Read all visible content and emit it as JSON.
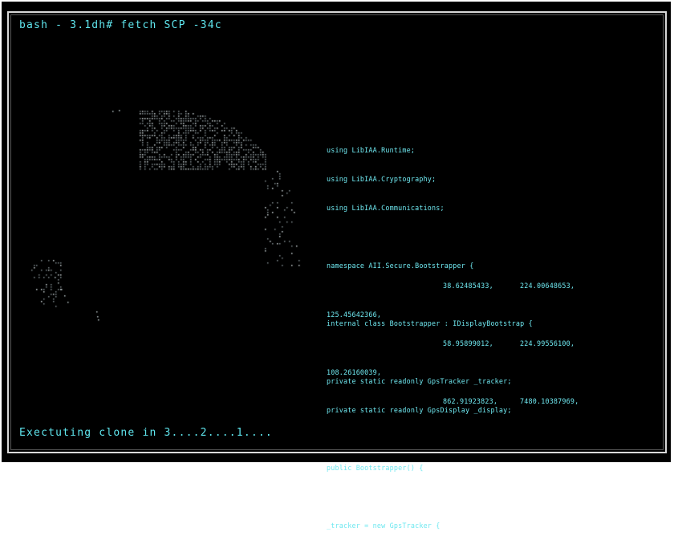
{
  "terminal": {
    "prompt_line": "bash - 3.1dh# fetch SCP -34c",
    "status_line": "Exectuting clone in 3....2....1...."
  },
  "code": {
    "lines": [
      "using LibIAA.Runtime;",
      "using LibIAA.Cryptography;",
      "using LibIAA.Communications;",
      "",
      "namespace AII.Secure.Bootstrapper {",
      "",
      "internal class Bootstrapper : IDisplayBootstrap {",
      "",
      "private static readonly GpsTracker _tracker;",
      "private static readonly GpsDisplay _display;",
      "",
      "public Bootstrapper() {",
      "",
      "_tracker = new GpsTracker {"
    ],
    "coordinates": [
      {
        "a": "38.62485433,",
        "b": "224.00648653,"
      },
      {
        "left": "125.45642366,"
      },
      {
        "a": "58.95899012,",
        "b": "224.99556100,"
      },
      {
        "left": "108.26160039,"
      },
      {
        "a": "862.91923823,",
        "b": "7480.10387969,"
      }
    ]
  },
  "colors": {
    "text": "#5fe6ee",
    "background": "#000000",
    "frame": "#d8d8d8"
  },
  "decor": {
    "globe_icon": "dotted-globe"
  }
}
